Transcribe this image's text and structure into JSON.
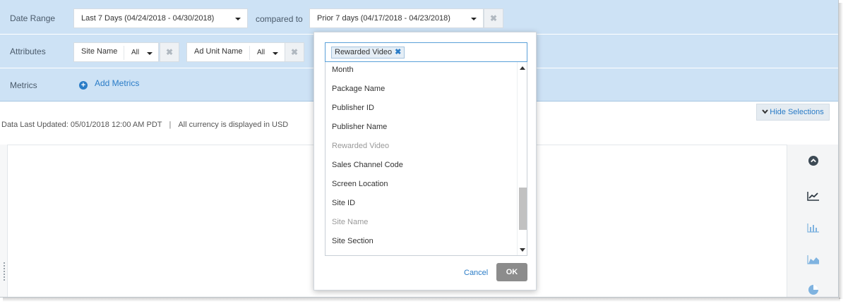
{
  "filters": {
    "date_range": {
      "label": "Date Range",
      "primary": "Last 7 Days (04/24/2018 - 04/30/2018)",
      "compared_to_label": "compared to",
      "comparison": "Prior 7 days (04/17/2018 - 04/23/2018)",
      "clear_symbol": "✖"
    },
    "attributes": {
      "label": "Attributes",
      "items": [
        {
          "name": "Site Name",
          "value": "All",
          "clear_symbol": "✖"
        },
        {
          "name": "Ad Unit Name",
          "value": "All",
          "clear_symbol": "✖"
        }
      ]
    },
    "metrics": {
      "label": "Metrics",
      "add_label": "Add Metrics",
      "add_symbol": "+"
    }
  },
  "hide_selections": {
    "label": "Hide Selections",
    "icon": "chevron-down-icon"
  },
  "info": {
    "last_updated": "Data Last Updated: 05/01/2018 12:00 AM PDT",
    "separator": "|",
    "currency": "All currency is displayed in USD"
  },
  "dropdown": {
    "selected_tags": [
      {
        "label": "Rewarded Video",
        "remove_symbol": "✖"
      }
    ],
    "options": [
      {
        "label": "Month",
        "disabled": false
      },
      {
        "label": "Package Name",
        "disabled": false
      },
      {
        "label": "Publisher ID",
        "disabled": false
      },
      {
        "label": "Publisher Name",
        "disabled": false
      },
      {
        "label": "Rewarded Video",
        "disabled": true
      },
      {
        "label": "Sales Channel Code",
        "disabled": false
      },
      {
        "label": "Screen Location",
        "disabled": false
      },
      {
        "label": "Site ID",
        "disabled": false
      },
      {
        "label": "Site Name",
        "disabled": true
      },
      {
        "label": "Site Section",
        "disabled": false
      }
    ],
    "cancel_label": "Cancel",
    "ok_label": "OK"
  },
  "side_tools": [
    {
      "icon": "chevron-up-circle-icon"
    },
    {
      "icon": "line-chart-icon"
    },
    {
      "icon": "bar-chart-icon"
    },
    {
      "icon": "area-chart-icon"
    },
    {
      "icon": "pie-chart-icon"
    }
  ],
  "colors": {
    "panel_bg": "#cde2f5",
    "link": "#2a7cc7",
    "ok_button": "#8c8c8c"
  }
}
